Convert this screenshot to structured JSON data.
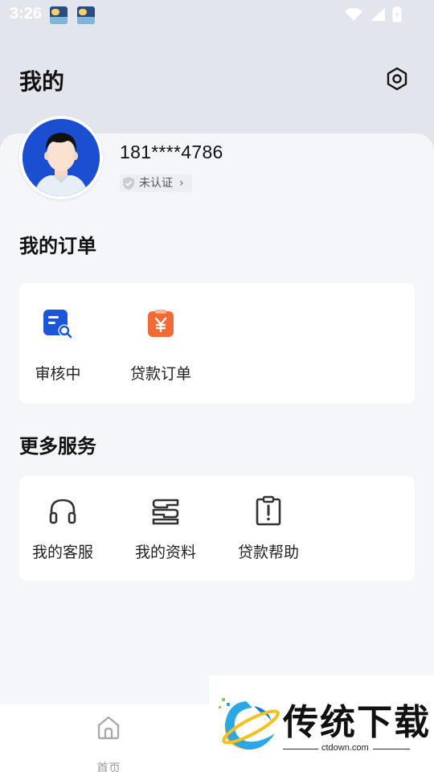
{
  "status_bar": {
    "time": "3:26"
  },
  "header": {
    "title": "我的",
    "settings_icon": "settings-icon"
  },
  "profile": {
    "phone": "181****4786",
    "verify_status": "未认证"
  },
  "orders": {
    "title": "我的订单",
    "items": [
      {
        "label": "审核中",
        "icon": "review-search-icon",
        "color": "#1a56d6"
      },
      {
        "label": "贷款订单",
        "icon": "yuan-clipboard-icon",
        "color": "#f26a35"
      }
    ]
  },
  "services": {
    "title": "更多服务",
    "items": [
      {
        "label": "我的客服",
        "icon": "headset-icon"
      },
      {
        "label": "我的资料",
        "icon": "documents-icon"
      },
      {
        "label": "贷款帮助",
        "icon": "clipboard-alert-icon"
      }
    ]
  },
  "bottom_nav": {
    "home_label": "首页"
  },
  "watermark": {
    "text": "传统下载",
    "url": "ctdown.com"
  },
  "colors": {
    "accent_blue": "#1a56d6",
    "accent_orange": "#f26a35",
    "background": "#f4f6f9"
  }
}
